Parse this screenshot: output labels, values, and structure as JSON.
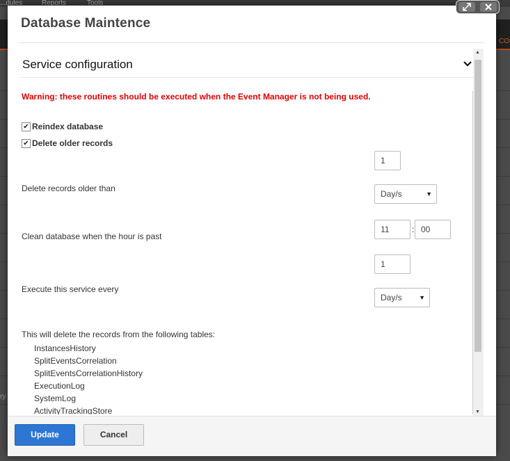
{
  "background": {
    "tab_labels": [
      "...dules",
      "Reports",
      "Tools"
    ],
    "side_text_right": "CON",
    "side_text_left": "ry"
  },
  "modal": {
    "title": "Database Maintence",
    "window_controls": {
      "expand_icon": "expand-icon",
      "close_icon": "close-icon"
    },
    "section": {
      "title": "Service configuration",
      "chevron_icon": "chevron-down-icon",
      "warning": "Warning: these routines should be executed when the Event Manager is not being used.",
      "reindex": {
        "label": "Reindex database",
        "checked": true
      },
      "delete_older": {
        "label": "Delete older records",
        "checked": true
      },
      "delete_older_than": {
        "label": "Delete records older than",
        "value": "1",
        "unit": "Day/s"
      },
      "clean_hour": {
        "label": "Clean database when the hour is past",
        "hour": "11",
        "separator": ":",
        "minute": "00"
      },
      "execute_every": {
        "label": "Execute this service every",
        "value": "1",
        "unit": "Day/s"
      },
      "tables_note": "This will delete the records from the following tables:",
      "tables": [
        "InstancesHistory",
        "SplitEventsCorrelation",
        "SplitEventsCorrelationHistory",
        "ExecutionLog",
        "SystemLog",
        "ActivityTrackingStore"
      ]
    },
    "footer": {
      "update_label": "Update",
      "cancel_label": "Cancel"
    }
  },
  "colors": {
    "primary": "#2d76d4",
    "warning": "#e00000",
    "accent_bar": "#b84b1a"
  }
}
